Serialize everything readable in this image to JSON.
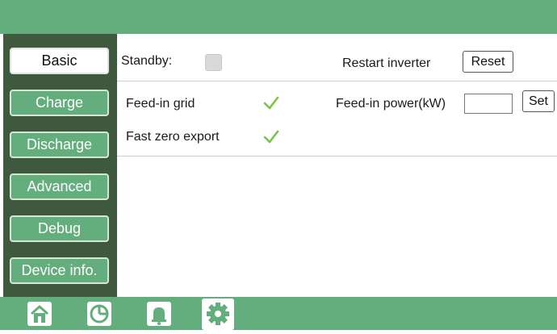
{
  "sidebar": {
    "items": [
      {
        "label": "Basic",
        "active": true
      },
      {
        "label": "Charge"
      },
      {
        "label": "Discharge"
      },
      {
        "label": "Advanced"
      },
      {
        "label": "Debug"
      },
      {
        "label": "Device info."
      }
    ]
  },
  "settings": {
    "standby_label": "Standby:",
    "restart_label": "Restart inverter",
    "reset_button": "Reset",
    "feed_in_grid_label": "Feed-in grid",
    "feed_in_power_label": "Feed-in power(kW)",
    "feed_in_power_value": "",
    "set_button": "Set",
    "fast_zero_export_label": "Fast zero export"
  },
  "bottom_nav": {
    "icons": [
      "home-icon",
      "pie-chart-icon",
      "bell-icon",
      "gear-icon"
    ],
    "active": "gear-icon"
  },
  "colors": {
    "accent": "#64ae7d",
    "sidebar_bg": "#3e593e",
    "check": "#7cc243"
  }
}
